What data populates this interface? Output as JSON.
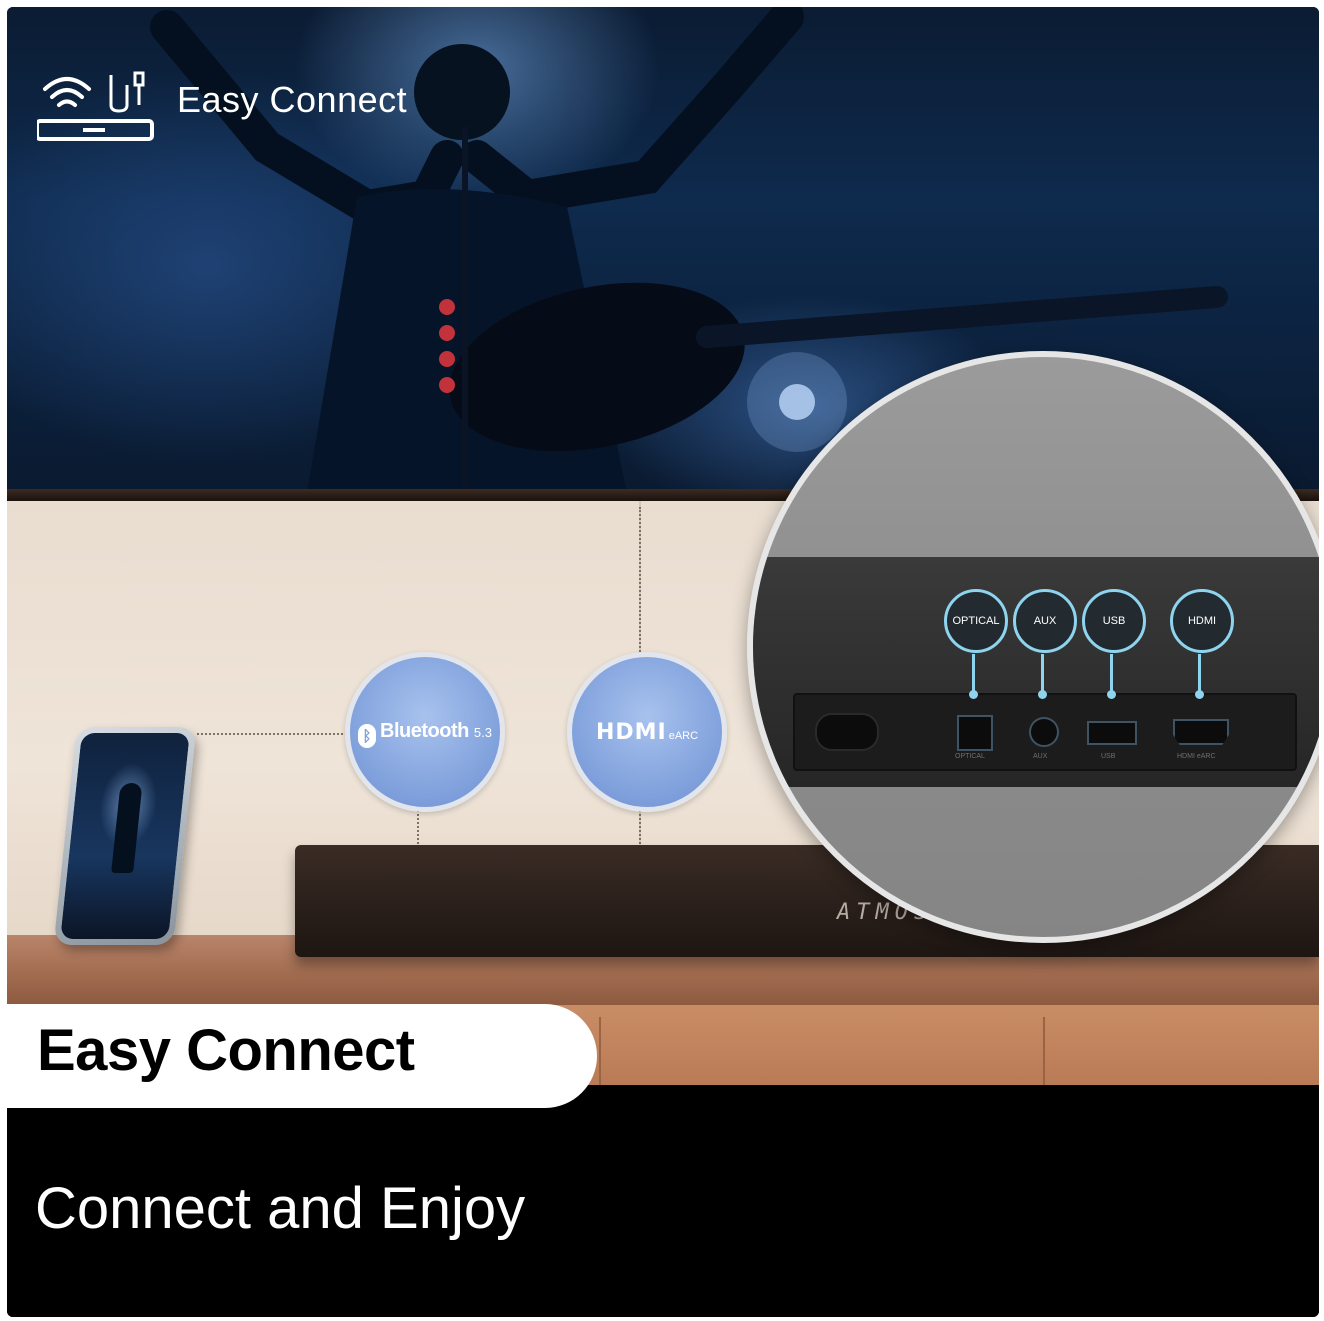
{
  "header": {
    "title": "Easy Connect",
    "icon": "soundbar-wifi-cable-icon"
  },
  "badges": {
    "bluetooth": {
      "label": "Bluetooth",
      "version": "5.3"
    },
    "hdmi": {
      "label": "HDMI",
      "sub": "eARC"
    }
  },
  "soundbar": {
    "brand_text": "ATMOS"
  },
  "ports": [
    {
      "label": "OPTICAL",
      "caption": "OPTICAL"
    },
    {
      "label": "AUX",
      "caption": "AUX"
    },
    {
      "label": "USB",
      "caption": "USB"
    },
    {
      "label": "HDMI",
      "caption": "HDMI eARC"
    }
  ],
  "footer": {
    "title": "Easy Connect",
    "subtitle": "Connect and Enjoy"
  },
  "colors": {
    "accent": "#8fd4ee",
    "badge": "#7e9fdb",
    "background": "#000000"
  }
}
